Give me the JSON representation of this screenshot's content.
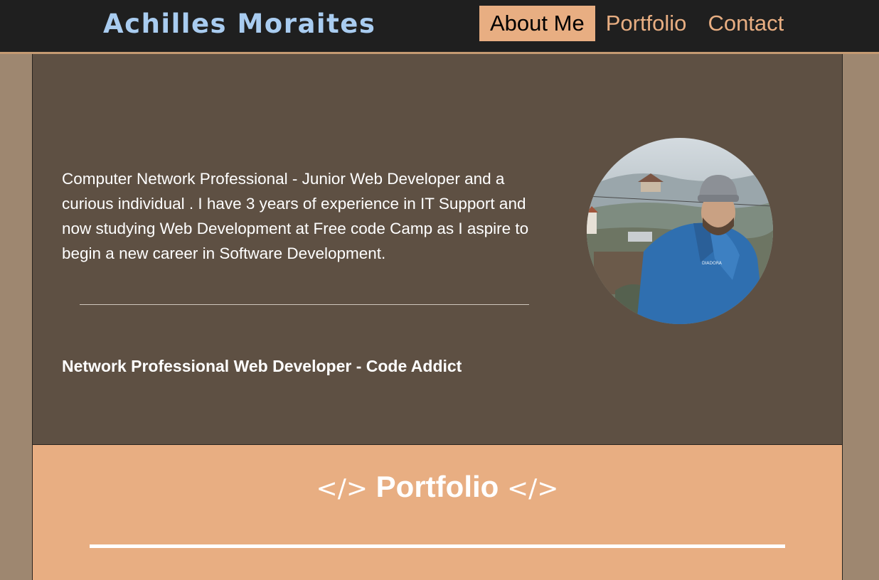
{
  "header": {
    "brand": "Achilles Moraites",
    "nav": [
      {
        "label": "About Me",
        "active": true
      },
      {
        "label": "Portfolio",
        "active": false
      },
      {
        "label": "Contact",
        "active": false
      }
    ]
  },
  "about": {
    "bio": "Computer Network Professional - Junior Web Developer and a curious individual . I have 3 years of experience in IT Support and now studying Web Development at Free code Camp as I aspire to begin a new career in Software Development.",
    "tagline": "Network Professional Web Developer - Code Addict",
    "avatar": {
      "icon": "profile-photo"
    }
  },
  "portfolio": {
    "code_glyph": "</>",
    "heading": "Portfolio"
  },
  "colors": {
    "nav_bg": "#1f1f1f",
    "brand": "#a9ccf0",
    "accent": "#e8ae82",
    "about_bg": "#5e5043",
    "page_bg": "#9e8770"
  }
}
